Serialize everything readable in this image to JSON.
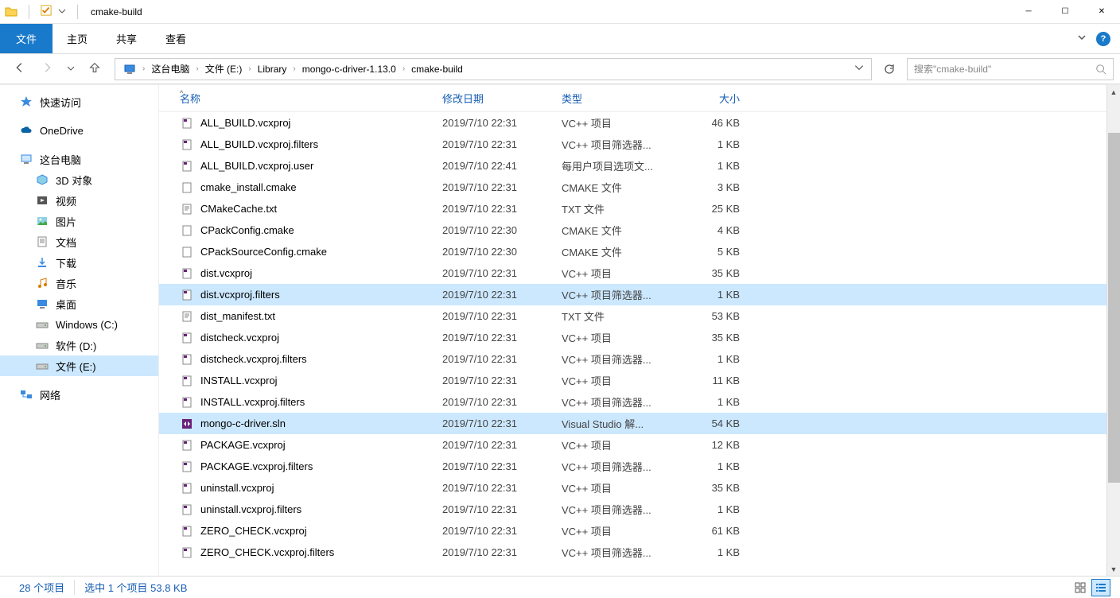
{
  "window": {
    "title": "cmake-build"
  },
  "ribbon": {
    "file": "文件",
    "tabs": [
      "主页",
      "共享",
      "查看"
    ]
  },
  "breadcrumb": [
    {
      "label": "这台电脑"
    },
    {
      "label": "文件 (E:)"
    },
    {
      "label": "Library"
    },
    {
      "label": "mongo-c-driver-1.13.0"
    },
    {
      "label": "cmake-build"
    }
  ],
  "search_placeholder": "搜索\"cmake-build\"",
  "sidebar": {
    "quick_access": "快速访问",
    "onedrive": "OneDrive",
    "this_pc": "这台电脑",
    "items": [
      {
        "label": "3D 对象",
        "icon": "3d"
      },
      {
        "label": "视频",
        "icon": "video"
      },
      {
        "label": "图片",
        "icon": "pictures"
      },
      {
        "label": "文档",
        "icon": "documents"
      },
      {
        "label": "下载",
        "icon": "downloads"
      },
      {
        "label": "音乐",
        "icon": "music"
      },
      {
        "label": "桌面",
        "icon": "desktop"
      },
      {
        "label": "Windows (C:)",
        "icon": "drive"
      },
      {
        "label": "软件 (D:)",
        "icon": "drive"
      },
      {
        "label": "文件 (E:)",
        "icon": "drive",
        "selected": true
      }
    ],
    "network": "网络"
  },
  "columns": {
    "name": "名称",
    "date": "修改日期",
    "type": "类型",
    "size": "大小"
  },
  "files": [
    {
      "name": "ALL_BUILD.vcxproj",
      "date": "2019/7/10 22:31",
      "type": "VC++ 项目",
      "size": "46 KB",
      "icon": "vcxproj"
    },
    {
      "name": "ALL_BUILD.vcxproj.filters",
      "date": "2019/7/10 22:31",
      "type": "VC++ 项目筛选器...",
      "size": "1 KB",
      "icon": "vcxfilt"
    },
    {
      "name": "ALL_BUILD.vcxproj.user",
      "date": "2019/7/10 22:41",
      "type": "每用户项目选项文...",
      "size": "1 KB",
      "icon": "vsuser"
    },
    {
      "name": "cmake_install.cmake",
      "date": "2019/7/10 22:31",
      "type": "CMAKE 文件",
      "size": "3 KB",
      "icon": "file"
    },
    {
      "name": "CMakeCache.txt",
      "date": "2019/7/10 22:31",
      "type": "TXT 文件",
      "size": "25 KB",
      "icon": "txt"
    },
    {
      "name": "CPackConfig.cmake",
      "date": "2019/7/10 22:30",
      "type": "CMAKE 文件",
      "size": "4 KB",
      "icon": "file"
    },
    {
      "name": "CPackSourceConfig.cmake",
      "date": "2019/7/10 22:30",
      "type": "CMAKE 文件",
      "size": "5 KB",
      "icon": "file"
    },
    {
      "name": "dist.vcxproj",
      "date": "2019/7/10 22:31",
      "type": "VC++ 项目",
      "size": "35 KB",
      "icon": "vcxproj"
    },
    {
      "name": "dist.vcxproj.filters",
      "date": "2019/7/10 22:31",
      "type": "VC++ 项目筛选器...",
      "size": "1 KB",
      "icon": "vcxfilt",
      "highlighted": true
    },
    {
      "name": "dist_manifest.txt",
      "date": "2019/7/10 22:31",
      "type": "TXT 文件",
      "size": "53 KB",
      "icon": "txt"
    },
    {
      "name": "distcheck.vcxproj",
      "date": "2019/7/10 22:31",
      "type": "VC++ 项目",
      "size": "35 KB",
      "icon": "vcxproj"
    },
    {
      "name": "distcheck.vcxproj.filters",
      "date": "2019/7/10 22:31",
      "type": "VC++ 项目筛选器...",
      "size": "1 KB",
      "icon": "vcxfilt"
    },
    {
      "name": "INSTALL.vcxproj",
      "date": "2019/7/10 22:31",
      "type": "VC++ 项目",
      "size": "11 KB",
      "icon": "vcxproj"
    },
    {
      "name": "INSTALL.vcxproj.filters",
      "date": "2019/7/10 22:31",
      "type": "VC++ 项目筛选器...",
      "size": "1 KB",
      "icon": "vcxfilt"
    },
    {
      "name": "mongo-c-driver.sln",
      "date": "2019/7/10 22:31",
      "type": "Visual Studio 解...",
      "size": "54 KB",
      "icon": "sln",
      "selected": true
    },
    {
      "name": "PACKAGE.vcxproj",
      "date": "2019/7/10 22:31",
      "type": "VC++ 项目",
      "size": "12 KB",
      "icon": "vcxproj"
    },
    {
      "name": "PACKAGE.vcxproj.filters",
      "date": "2019/7/10 22:31",
      "type": "VC++ 项目筛选器...",
      "size": "1 KB",
      "icon": "vcxfilt"
    },
    {
      "name": "uninstall.vcxproj",
      "date": "2019/7/10 22:31",
      "type": "VC++ 项目",
      "size": "35 KB",
      "icon": "vcxproj"
    },
    {
      "name": "uninstall.vcxproj.filters",
      "date": "2019/7/10 22:31",
      "type": "VC++ 项目筛选器...",
      "size": "1 KB",
      "icon": "vcxfilt"
    },
    {
      "name": "ZERO_CHECK.vcxproj",
      "date": "2019/7/10 22:31",
      "type": "VC++ 项目",
      "size": "61 KB",
      "icon": "vcxproj"
    },
    {
      "name": "ZERO_CHECK.vcxproj.filters",
      "date": "2019/7/10 22:31",
      "type": "VC++ 项目筛选器...",
      "size": "1 KB",
      "icon": "vcxfilt"
    }
  ],
  "status": {
    "count": "28 个项目",
    "selection": "选中 1 个项目  53.8 KB"
  }
}
